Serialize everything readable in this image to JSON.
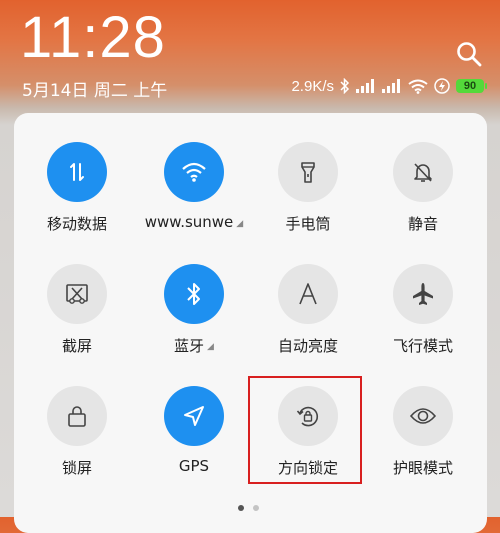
{
  "status_bar": {
    "time": "11:28",
    "date": "5月14日 周二 上午",
    "network_speed": "2.9K/s",
    "battery": "90",
    "icons": [
      "bluetooth-icon",
      "signal-icon",
      "signal-icon",
      "wifi-icon",
      "charging-icon",
      "battery-icon"
    ]
  },
  "quick_settings": {
    "tiles": [
      {
        "label": "移动数据",
        "icon": "mobile-data-icon",
        "active": true,
        "has_menu": false
      },
      {
        "label": "www.sunwe",
        "icon": "wifi-icon",
        "active": true,
        "has_menu": true
      },
      {
        "label": "手电筒",
        "icon": "flashlight-icon",
        "active": false,
        "has_menu": false
      },
      {
        "label": "静音",
        "icon": "bell-off-icon",
        "active": false,
        "has_menu": false
      },
      {
        "label": "截屏",
        "icon": "screenshot-icon",
        "active": false,
        "has_menu": false
      },
      {
        "label": "蓝牙",
        "icon": "bluetooth-icon",
        "active": true,
        "has_menu": true
      },
      {
        "label": "自动亮度",
        "icon": "auto-brightness-icon",
        "active": false,
        "has_menu": false
      },
      {
        "label": "飞行模式",
        "icon": "airplane-icon",
        "active": false,
        "has_menu": false
      },
      {
        "label": "锁屏",
        "icon": "lock-icon",
        "active": false,
        "has_menu": false
      },
      {
        "label": "GPS",
        "icon": "gps-icon",
        "active": true,
        "has_menu": false
      },
      {
        "label": "方向锁定",
        "icon": "rotation-lock-icon",
        "active": false,
        "has_menu": false
      },
      {
        "label": "护眼模式",
        "icon": "eye-icon",
        "active": false,
        "has_menu": false
      }
    ],
    "page_count": 2,
    "current_page": 1
  },
  "colors": {
    "accent": "#1e90f0",
    "highlight_box": "#d81f1f",
    "tile_off": "#e5e5e5"
  }
}
